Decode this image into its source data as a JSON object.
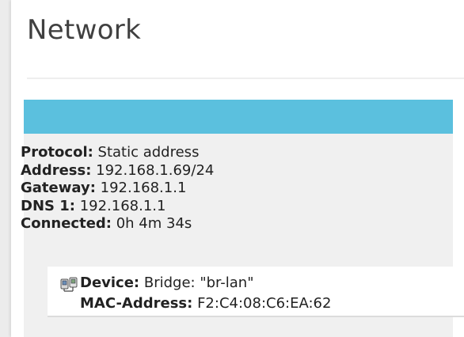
{
  "page": {
    "title": "Network"
  },
  "status": {
    "header_color": "#5bc0de",
    "rows": [
      {
        "key": "Protocol:",
        "value": " Static address"
      },
      {
        "key": "Address:",
        "value": " 192.168.1.69/24"
      },
      {
        "key": "Gateway:",
        "value": " 192.168.1.1"
      },
      {
        "key": "DNS 1:",
        "value": " 192.168.1.1"
      },
      {
        "key": "Connected:",
        "value": " 0h 4m 34s"
      }
    ]
  },
  "device": {
    "icon": "ethernet-bridge-icon",
    "device_key": "Device:",
    "device_value": " Bridge: \"br-lan\"",
    "mac_key": "MAC-Address:",
    "mac_value": " F2:C4:08:C6:EA:62"
  }
}
